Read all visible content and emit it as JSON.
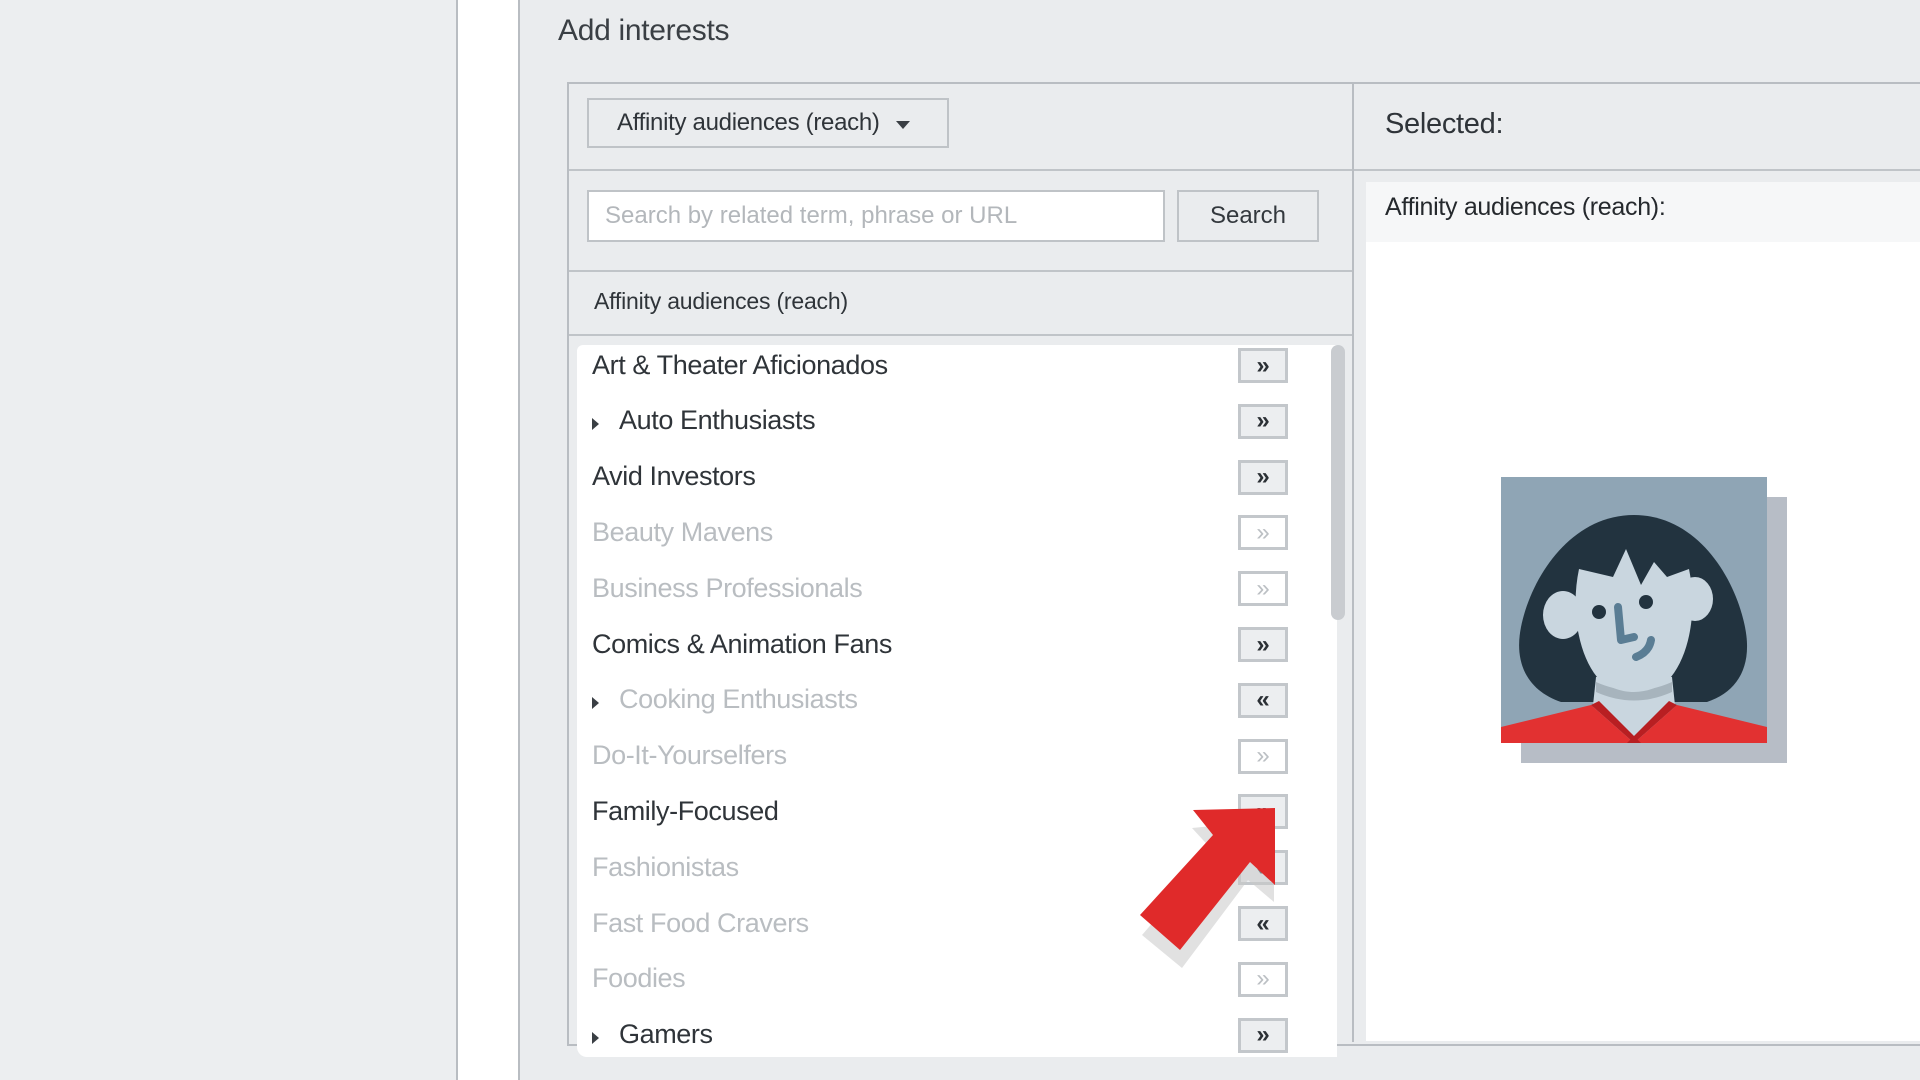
{
  "page": {
    "title": "Add interests"
  },
  "left_column": {
    "dropdown": {
      "selected": "Affinity audiences (reach)",
      "icon": "caret-down-icon"
    },
    "search": {
      "placeholder": "Search by related term, phrase or URL",
      "value": "",
      "button_label": "Search"
    },
    "category_header": "Affinity audiences (reach)",
    "items": [
      {
        "label": "Art & Theater Aficionados",
        "expandable": false,
        "state": "active",
        "button": "add",
        "button_glyph": "»"
      },
      {
        "label": "Auto Enthusiasts",
        "expandable": true,
        "state": "active",
        "button": "add",
        "button_glyph": "»"
      },
      {
        "label": "Avid Investors",
        "expandable": false,
        "state": "active",
        "button": "add",
        "button_glyph": "»"
      },
      {
        "label": "Beauty Mavens",
        "expandable": false,
        "state": "inactive",
        "button": "add",
        "button_glyph": "»"
      },
      {
        "label": "Business Professionals",
        "expandable": false,
        "state": "inactive",
        "button": "add",
        "button_glyph": "»"
      },
      {
        "label": "Comics & Animation Fans",
        "expandable": false,
        "state": "active",
        "button": "add",
        "button_glyph": "»"
      },
      {
        "label": "Cooking Enthusiasts",
        "expandable": true,
        "state": "inactive",
        "button": "remove",
        "button_glyph": "«"
      },
      {
        "label": "Do-It-Yourselfers",
        "expandable": false,
        "state": "inactive",
        "button": "add",
        "button_glyph": "»"
      },
      {
        "label": "Family-Focused",
        "expandable": false,
        "state": "active",
        "button": "add",
        "button_glyph": "»"
      },
      {
        "label": "Fashionistas",
        "expandable": false,
        "state": "inactive",
        "button": "remove",
        "button_glyph": "«"
      },
      {
        "label": "Fast Food Cravers",
        "expandable": false,
        "state": "inactive",
        "button": "remove",
        "button_glyph": "«"
      },
      {
        "label": "Foodies",
        "expandable": false,
        "state": "inactive",
        "button": "add",
        "button_glyph": "»"
      },
      {
        "label": "Gamers",
        "expandable": true,
        "state": "active",
        "button": "add",
        "button_glyph": "»"
      }
    ]
  },
  "right_column": {
    "title": "Selected:",
    "subheader": "Affinity audiences (reach):",
    "avatar": "person-avatar-illustration"
  },
  "annotation": {
    "type": "red-arrow-pointer",
    "target": "Family-Focused add button",
    "color": "#e02a2a"
  },
  "colors": {
    "accent_red": "#e02a2a",
    "active_text": "#2f3439",
    "inactive_text": "#b9bdc1",
    "border": "#b9bdc2"
  }
}
